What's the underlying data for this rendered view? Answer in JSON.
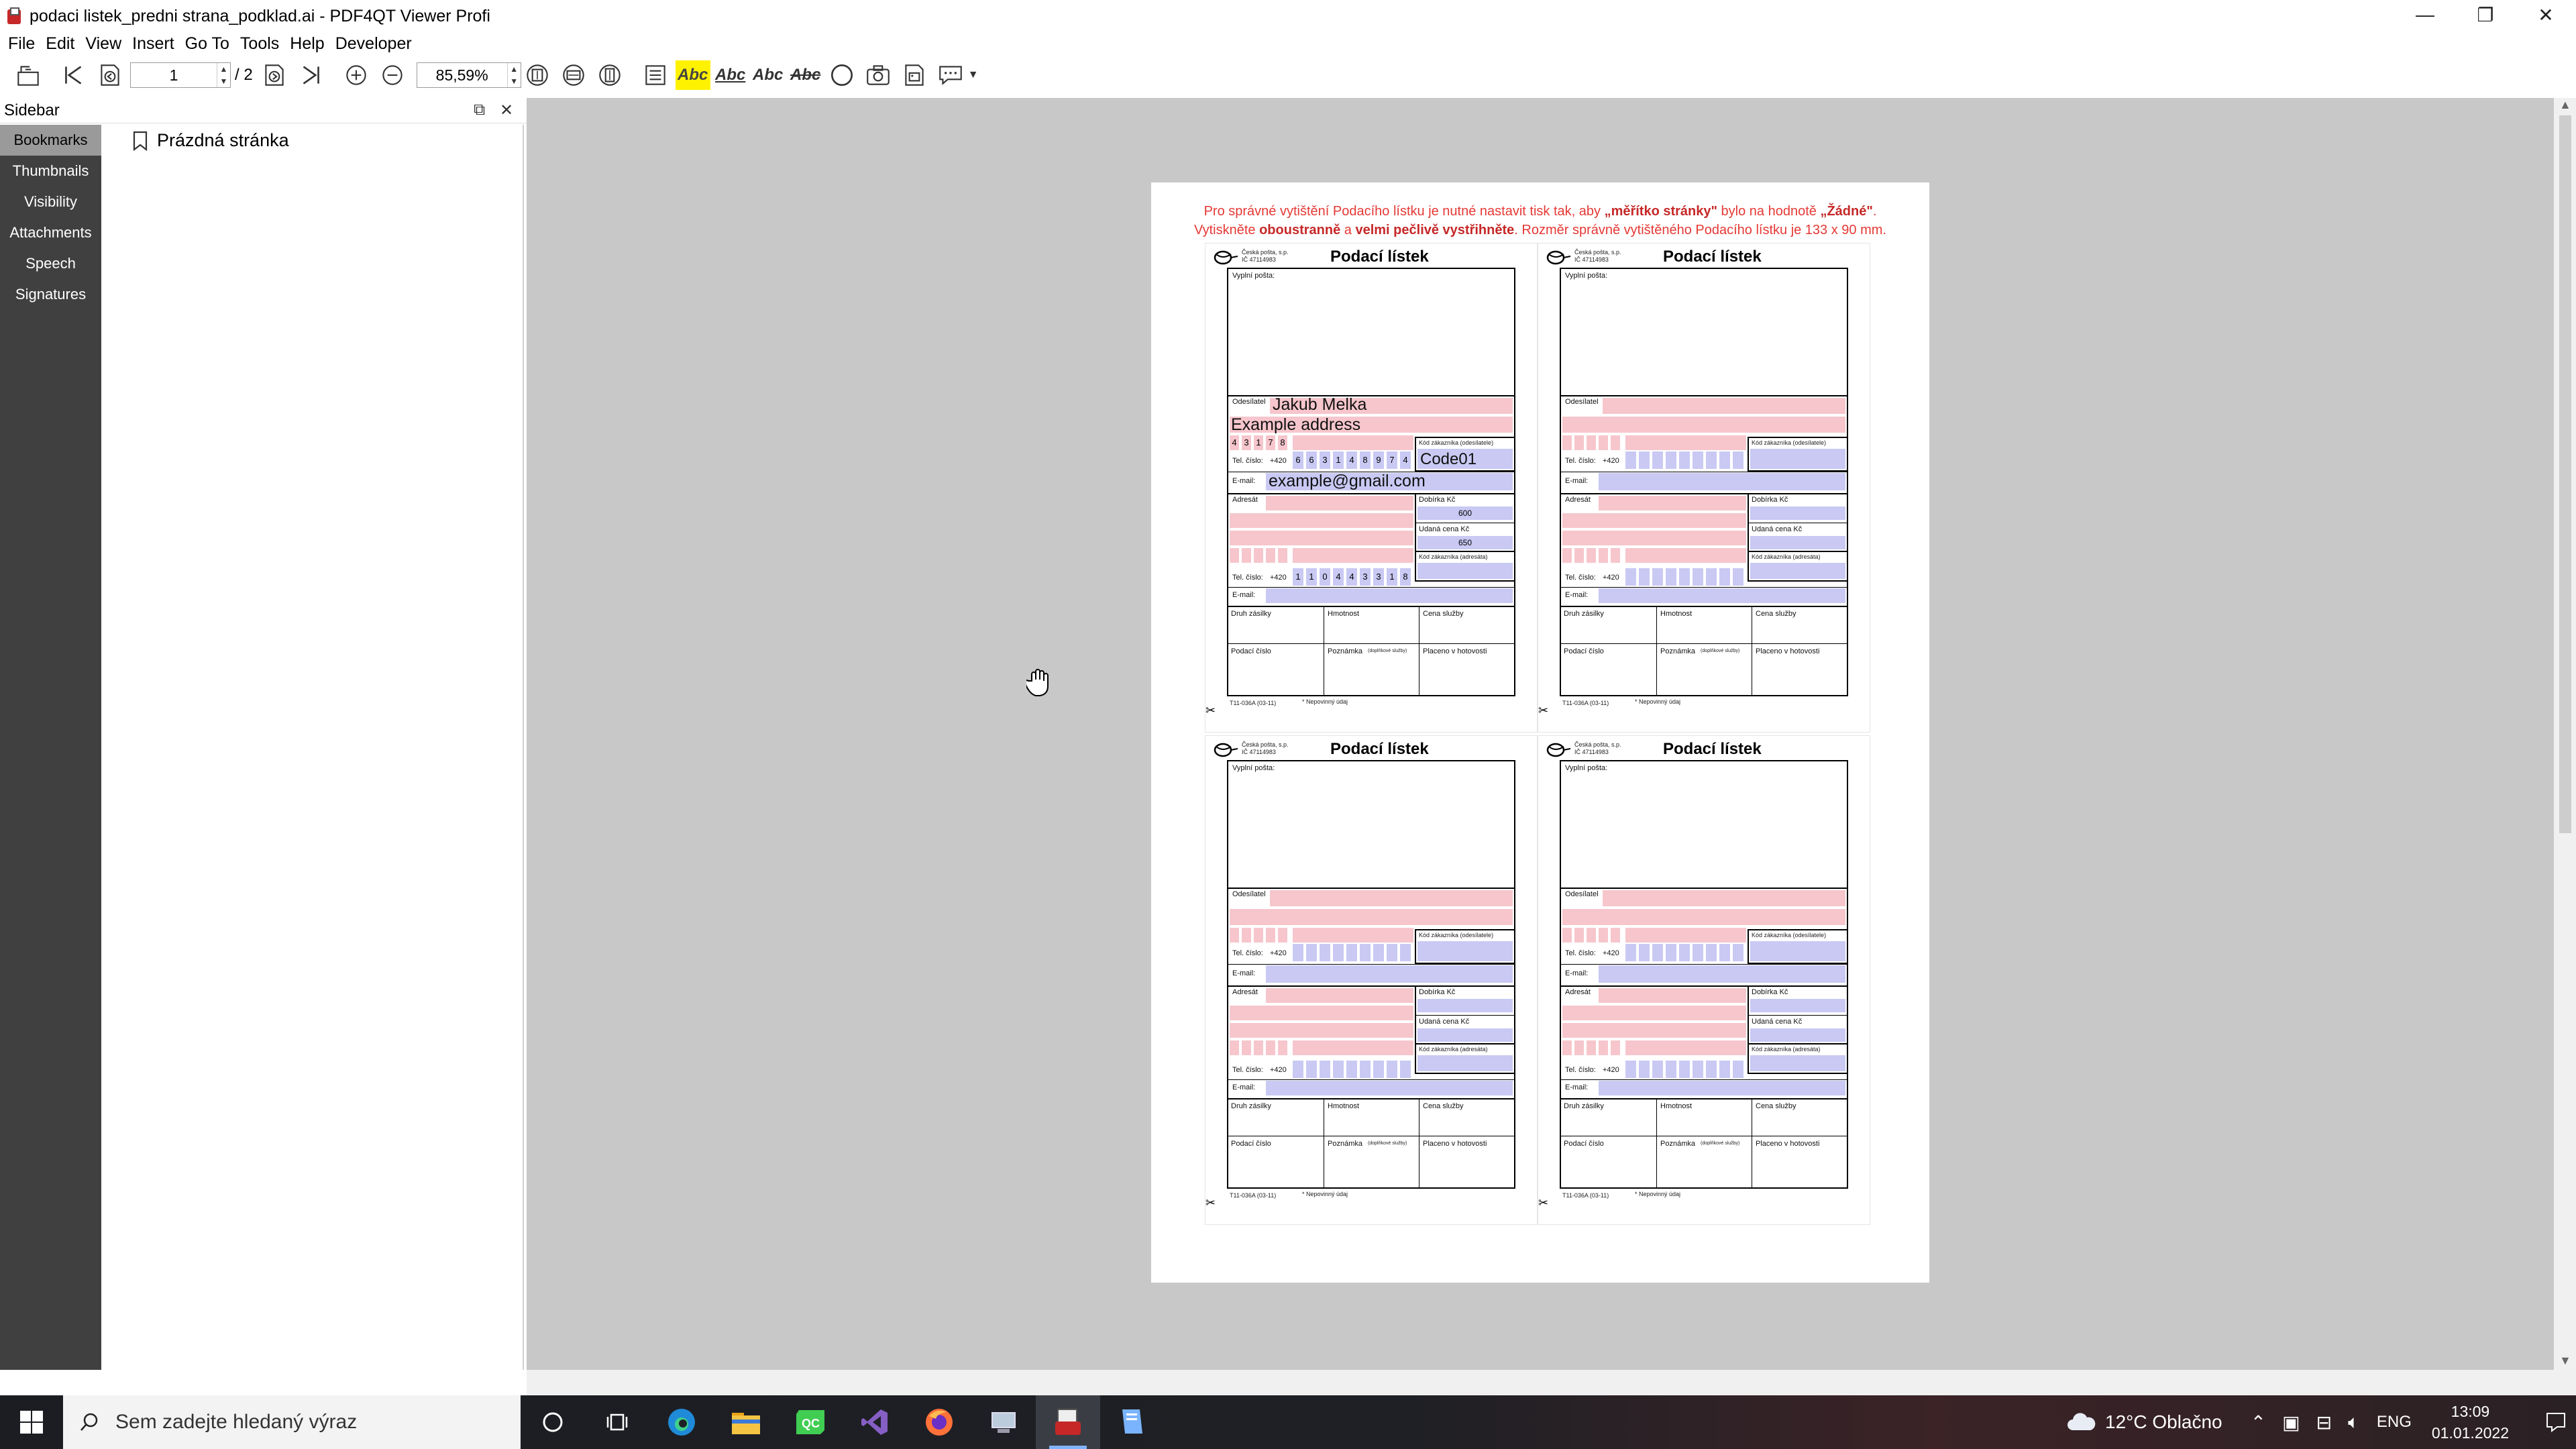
{
  "window": {
    "title": "podaci listek_predni strana_podklad.ai - PDF4QT Viewer Profi",
    "min_label": "—",
    "max_label": "❐",
    "close_label": "✕"
  },
  "menu": [
    "File",
    "Edit",
    "View",
    "Insert",
    "Go To",
    "Tools",
    "Help",
    "Developer"
  ],
  "toolbar": {
    "page_current": "1",
    "page_total": "/ 2",
    "zoom": "85,59%",
    "abc_label": "Abc"
  },
  "sidebar": {
    "title": "Sidebar",
    "tabs": [
      "Bookmarks",
      "Thumbnails",
      "Visibility",
      "Attachments",
      "Speech",
      "Signatures"
    ],
    "active_tab": "Bookmarks",
    "bookmark": "Prázdná stránka"
  },
  "document": {
    "note_line1_pre": "Pro správné vytištění Podacího lístku je nutné nastavit tisk tak, aby ",
    "note_line1_b1": "„měřítko stránky\"",
    "note_line1_mid": " bylo na hodnotě ",
    "note_line1_b2": "„Žádné\"",
    "note_line1_end": ".",
    "note_line2_pre": "Vytiskněte ",
    "note_line2_b1": "oboustranně",
    "note_line2_mid": " a ",
    "note_line2_b2": "velmi pečlivě vystřihněte",
    "note_line2_end": ". Rozměr správně vytištěného Podacího lístku je 133 x 90 mm.",
    "slip": {
      "title": "Podací lístek",
      "company_line1": "Česká pošta, s.p.",
      "company_line2": "IČ 47114983",
      "vyplni": "Vyplní pošta:",
      "odesilatel": "Odesílatel",
      "tel": "Tel. číslo:",
      "prefix": "+420",
      "email": "E-mail:",
      "kod_odes": "Kód zákazníka (odesílatele)",
      "adresat": "Adresát",
      "dobirka": "Dobírka Kč",
      "udana": "Udaná cena Kč",
      "kod_adres": "Kód zákazníka (adresáta)",
      "druh": "Druh zásilky",
      "hmotnost": "Hmotnost",
      "cena": "Cena služby",
      "podaci_cislo": "Podací číslo",
      "poznamka": "Poznámka",
      "poznamka_small": "(doplňkové služby)",
      "placeno": "Placeno v hotovosti",
      "footer_code": "T11-036A (03-11)",
      "footer_note": "* Nepovinný údaj",
      "scissors": "✂"
    },
    "filled": {
      "name": "Jakub Melka",
      "address": "Example address",
      "zip": [
        "4",
        "3",
        "1",
        "7",
        "8"
      ],
      "phone": [
        "6",
        "6",
        "3",
        "1",
        "4",
        "8",
        "9",
        "7",
        "4"
      ],
      "code": "Code01",
      "email": "example@gmail.com",
      "dobirka": "600",
      "udana": "650",
      "phone2": [
        "1",
        "1",
        "0",
        "4",
        "4",
        "3",
        "3",
        "1",
        "8"
      ]
    }
  },
  "taskbar": {
    "search_placeholder": "Sem zadejte hledaný výraz",
    "weather": "12°C  Oblačno",
    "lang": "ENG",
    "time": "13:09",
    "date": "01.01.2022"
  }
}
